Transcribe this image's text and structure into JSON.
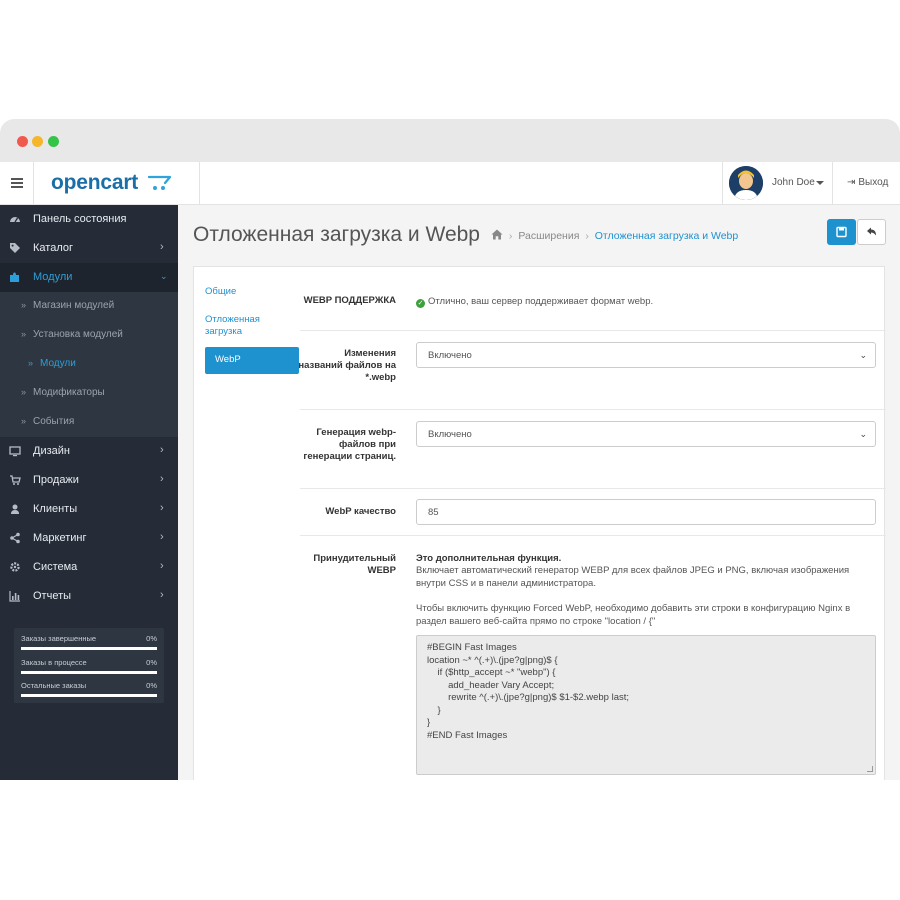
{
  "app": {
    "logo_text": "opencart",
    "user_name": "John Doe",
    "logout_label": "Выход"
  },
  "sidebar": {
    "items": [
      {
        "label": "Панель состояния",
        "icon": "dashboard-icon"
      },
      {
        "label": "Каталог",
        "icon": "tag-icon"
      },
      {
        "label": "Модули",
        "icon": "puzzle-icon"
      },
      {
        "label": "Магазин модулей"
      },
      {
        "label": "Установка модулей"
      },
      {
        "label": "Модули"
      },
      {
        "label": "Модификаторы"
      },
      {
        "label": "События"
      },
      {
        "label": "Дизайн",
        "icon": "monitor-icon"
      },
      {
        "label": "Продажи",
        "icon": "cart-icon"
      },
      {
        "label": "Клиенты",
        "icon": "user-icon"
      },
      {
        "label": "Маркетинг",
        "icon": "share-icon"
      },
      {
        "label": "Система",
        "icon": "gear-icon"
      },
      {
        "label": "Отчеты",
        "icon": "bar-chart-icon"
      }
    ],
    "stats": [
      {
        "label": "Заказы завершенные",
        "value": "0%"
      },
      {
        "label": "Заказы в процессе",
        "value": "0%"
      },
      {
        "label": "Остальные заказы",
        "value": "0%"
      }
    ]
  },
  "page": {
    "title": "Отложенная загрузка и Webp",
    "breadcrumb": [
      "Расширения",
      "Отложенная загрузка и Webp"
    ]
  },
  "tabs": [
    "Общие",
    "Отложенная загрузка",
    "WebP"
  ],
  "form": {
    "webp_support_label": "WEBP ПОДДЕРЖКА",
    "webp_support_msg": "Отлично, ваш сервер поддерживает формат webp.",
    "rename_label": "Изменения названий файлов на *.webp",
    "rename_value": "Включено",
    "generate_label": "Генерация webp-файлов при генерации страниц.",
    "generate_value": "Включено",
    "quality_label": "WebP качество",
    "quality_value": "85",
    "forced_label": "Принудительный WEBP",
    "forced_title": "Это дополнительная функция.",
    "forced_desc": "Включает автоматический генератор WEBP для всех файлов JPEG и PNG, включая изображения внутри CSS и в панели администратора.",
    "forced_nginx": "Чтобы включить функцию Forced WebP, необходимо добавить эти строки в конфигурацию Nginx в раздел вашего веб-сайта прямо по строке \"location / {\"",
    "code": "#BEGIN Fast Images\nlocation ~* ^(.+)\\.(jpe?g|png)$ {\n    if ($http_accept ~* \"webp\") {\n        add_header Vary Accept;\n        rewrite ^(.+)\\.(jpe?g|png)$ $1-$2.webp last;\n    }\n}\n#END Fast Images"
  },
  "colors": {
    "accent": "#1e91cf",
    "sidebar_bg": "#252c37",
    "success": "#3ca13c"
  }
}
